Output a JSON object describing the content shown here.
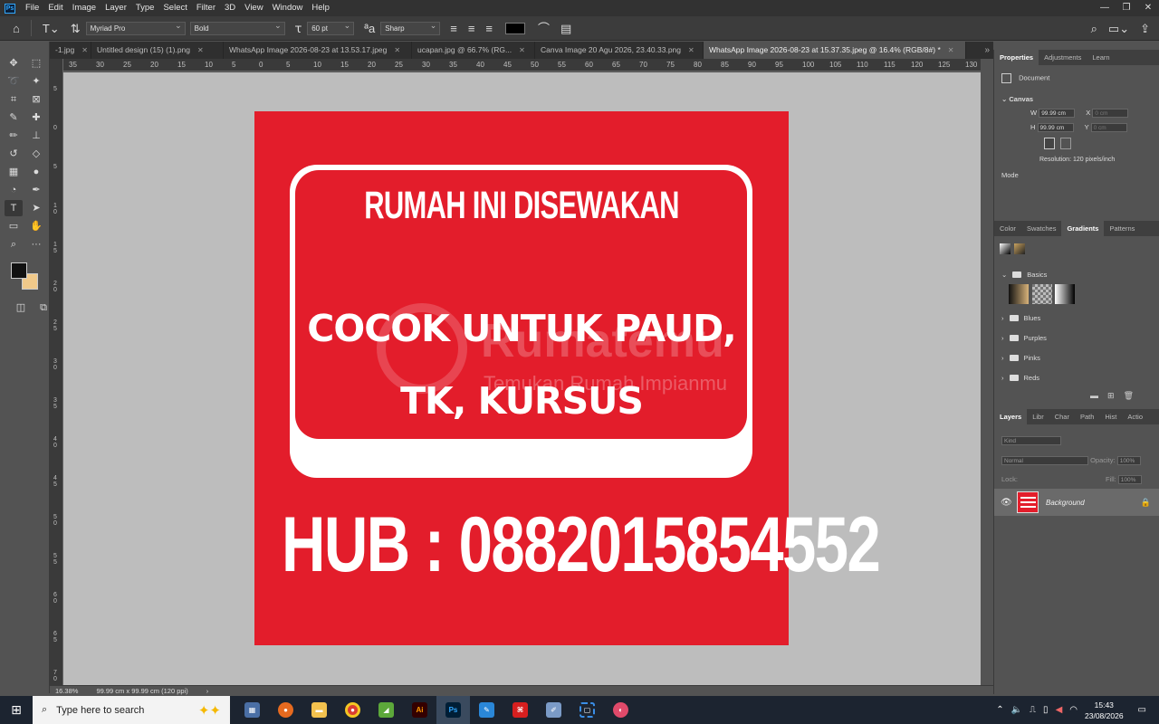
{
  "menu": [
    "File",
    "Edit",
    "Image",
    "Layer",
    "Type",
    "Select",
    "Filter",
    "3D",
    "View",
    "Window",
    "Help"
  ],
  "options": {
    "font_family": "Myriad Pro",
    "font_style": "Bold",
    "font_size": "60 pt",
    "antialias": "Sharp"
  },
  "tabs": [
    {
      "label": "-1.jpg"
    },
    {
      "label": "Untitled design (15) (1).png"
    },
    {
      "label": "WhatsApp Image 2026-08-23 at 13.53.17.jpeg"
    },
    {
      "label": "ucapan.jpg @ 66.7% (RG..."
    },
    {
      "label": "Canva Image 20 Agu 2026, 23.40.33.png"
    },
    {
      "label": "WhatsApp Image 2026-08-23 at 15.37.35.jpeg @ 16.4% (RGB/8#) *"
    }
  ],
  "ruler_h": [
    "35",
    "30",
    "25",
    "20",
    "15",
    "10",
    "5",
    "0",
    "5",
    "10",
    "15",
    "20",
    "25",
    "30",
    "35",
    "40",
    "45",
    "50",
    "55",
    "60",
    "65",
    "70",
    "75",
    "80",
    "85",
    "90",
    "95",
    "100",
    "105",
    "110",
    "115",
    "120",
    "125",
    "130"
  ],
  "ruler_v": [
    "5",
    "0",
    "5",
    "1 0",
    "1 5",
    "2 0",
    "2 5",
    "3 0",
    "3 5",
    "4 0",
    "4 5",
    "5 0",
    "5 5",
    "6 0",
    "6 5",
    "7 0"
  ],
  "document": {
    "line1": "RUMAH INI DISEWAKAN",
    "line2": "COCOK UNTUK PAUD,",
    "line3": "TK, KURSUS",
    "phone": "HUB : 0882015854552",
    "watermark_name": "Rumatemu",
    "watermark_tagline": "Temukan Rumah Impianmu",
    "bg_color": "#e31d2b"
  },
  "status": {
    "zoom": "16.38%",
    "doc_size": "99.99 cm x 99.99 cm (120 ppi)"
  },
  "properties": {
    "tabs": [
      "Properties",
      "Adjustments",
      "Learn"
    ],
    "doc_label": "Document",
    "canvas_label": "Canvas",
    "w_label": "W",
    "w_value": "99.99 cm",
    "h_label": "H",
    "h_value": "99.99 cm",
    "x_label": "X",
    "x_value": "0 cm",
    "y_label": "Y",
    "y_value": "0 cm",
    "resolution": "Resolution: 120 pixels/inch",
    "mode_label": "Mode"
  },
  "gradients": {
    "tabs": [
      "Color",
      "Swatches",
      "Gradients",
      "Patterns"
    ],
    "folders": [
      "Basics",
      "Blues",
      "Purples",
      "Pinks",
      "Reds"
    ]
  },
  "layers": {
    "tabs": [
      "Layers",
      "Libr",
      "Char",
      "Path",
      "Hist",
      "Actio"
    ],
    "kind_placeholder": "Kind",
    "blend_mode": "Normal",
    "opacity_label": "Opacity:",
    "opacity_value": "100%",
    "lock_label": "Lock:",
    "fill_label": "Fill:",
    "fill_value": "100%",
    "layer_name": "Background"
  },
  "taskbar": {
    "search_placeholder": "Type here to search",
    "time": "15:43",
    "date": "23/08/2026"
  }
}
